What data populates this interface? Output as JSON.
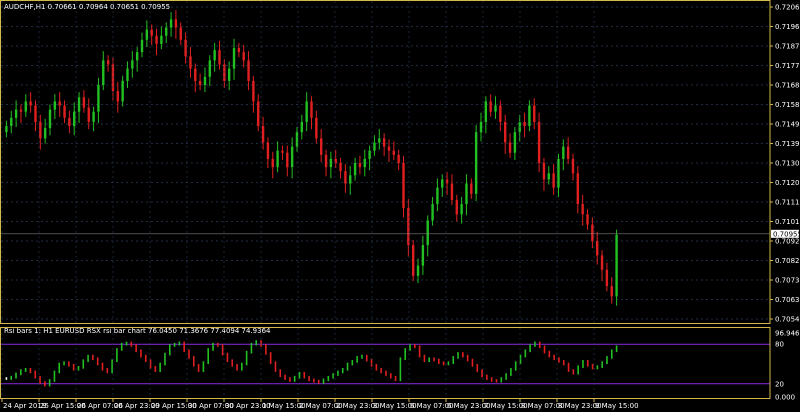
{
  "main_title": "AUDCHF,H1  0.70661 0.70964 0.70651 0.70955",
  "indicator_title": "Rsi bars 1: H1 EURUSD RSX rsi bar chart 76.0450 71.3676 77.4094 74.9364",
  "colors": {
    "background": "#000000",
    "frame": "#d4b84a",
    "grid": "#2a3a5a",
    "bull": "#22c022",
    "bear": "#e02020",
    "doji": "#ffffff",
    "rsi_level": "#8a2be2",
    "price_tag": "#ffffff"
  },
  "chart_data": [
    {
      "type": "line",
      "title": "AUDCHF,H1  0.70661 0.70964 0.70651 0.70955",
      "ylim": [
        0.7054,
        0.7206
      ],
      "y_ticks": [
        "0.72060",
        "0.71965",
        "0.71870",
        "0.71775",
        "0.71680",
        "0.71585",
        "0.71490",
        "0.71395",
        "0.71300",
        "0.71205",
        "0.71110",
        "0.71015",
        "0.70920",
        "0.70825",
        "0.70730",
        "0.70635",
        "0.70540"
      ],
      "current_price_label": "0.70955",
      "x_ticks": [
        "24 Apr 2019",
        "25 Apr 15:00",
        "26 Apr 07:00",
        "26 Apr 23:00",
        "29 Apr 15:00",
        "30 Apr 07:00",
        "30 Apr 23:00",
        "1 May 15:00",
        "2 May 07:00",
        "2 May 23:00",
        "3 May 15:00",
        "6 May 07:00",
        "6 May 23:00",
        "7 May 15:00",
        "8 May 07:00",
        "8 May 23:00",
        "9 May 15:00"
      ],
      "series": [
        {
          "values": [
            0.7148,
            0.7152,
            0.7156,
            0.7155,
            0.716,
            0.7158,
            0.715,
            0.7142,
            0.7147,
            0.7156,
            0.716,
            0.7158,
            0.7152,
            0.7148,
            0.7155,
            0.7162,
            0.7157,
            0.715,
            0.7155,
            0.7168,
            0.718,
            0.7178,
            0.7165,
            0.716,
            0.717,
            0.7176,
            0.718,
            0.7184,
            0.719,
            0.7195,
            0.7192,
            0.7188,
            0.7192,
            0.7196,
            0.72,
            0.7196,
            0.719,
            0.7182,
            0.7176,
            0.717,
            0.7168,
            0.7172,
            0.718,
            0.7185,
            0.7178,
            0.717,
            0.7176,
            0.7186,
            0.7184,
            0.718,
            0.717,
            0.716,
            0.7148,
            0.714,
            0.7132,
            0.7128,
            0.7136,
            0.7135,
            0.7128,
            0.7138,
            0.7145,
            0.715,
            0.716,
            0.7152,
            0.7142,
            0.7134,
            0.7128,
            0.7132,
            0.713,
            0.7126,
            0.712,
            0.7124,
            0.713,
            0.7128,
            0.7132,
            0.7136,
            0.714,
            0.7142,
            0.7138,
            0.7136,
            0.7134,
            0.713,
            0.7108,
            0.709,
            0.7075,
            0.708,
            0.709,
            0.7102,
            0.711,
            0.7118,
            0.7122,
            0.712,
            0.7112,
            0.7105,
            0.711,
            0.712,
            0.7115,
            0.7145,
            0.715,
            0.716,
            0.7155,
            0.7158,
            0.715,
            0.714,
            0.7135,
            0.7145,
            0.715,
            0.7148,
            0.7158,
            0.715,
            0.713,
            0.7122,
            0.7125,
            0.7118,
            0.7132,
            0.7138,
            0.7132,
            0.7125,
            0.711,
            0.7105,
            0.71,
            0.7092,
            0.7085,
            0.7078,
            0.707,
            0.7065,
            0.7095
          ]
        }
      ]
    },
    {
      "type": "line",
      "title": "Rsi bars 1: H1 EURUSD RSX rsi bar chart 76.0450 71.3676 77.4094 74.9364",
      "ylim": [
        0,
        100
      ],
      "y_ticks": [
        "96.946",
        "80",
        "20",
        "0.000"
      ],
      "levels": [
        80,
        20
      ],
      "series": [
        {
          "values": [
            28,
            30,
            35,
            40,
            42,
            38,
            30,
            22,
            18,
            25,
            38,
            50,
            52,
            48,
            42,
            45,
            55,
            62,
            58,
            50,
            42,
            38,
            55,
            72,
            80,
            82,
            78,
            70,
            62,
            55,
            45,
            40,
            50,
            65,
            78,
            80,
            82,
            70,
            60,
            48,
            40,
            52,
            72,
            80,
            78,
            65,
            55,
            48,
            42,
            50,
            68,
            80,
            84,
            78,
            66,
            52,
            40,
            32,
            28,
            25,
            30,
            36,
            30,
            26,
            24,
            22,
            26,
            30,
            34,
            38,
            42,
            50,
            54,
            60,
            62,
            56,
            48,
            42,
            38,
            34,
            30,
            26,
            58,
            72,
            78,
            76,
            62,
            55,
            58,
            56,
            52,
            50,
            52,
            60,
            66,
            62,
            56,
            48,
            40,
            32,
            28,
            25,
            24,
            28,
            34,
            42,
            52,
            62,
            70,
            78,
            82,
            76,
            68,
            62,
            58,
            54,
            50,
            40,
            36,
            46,
            54,
            48,
            44,
            46,
            52,
            60,
            70,
            76
          ]
        }
      ]
    }
  ]
}
